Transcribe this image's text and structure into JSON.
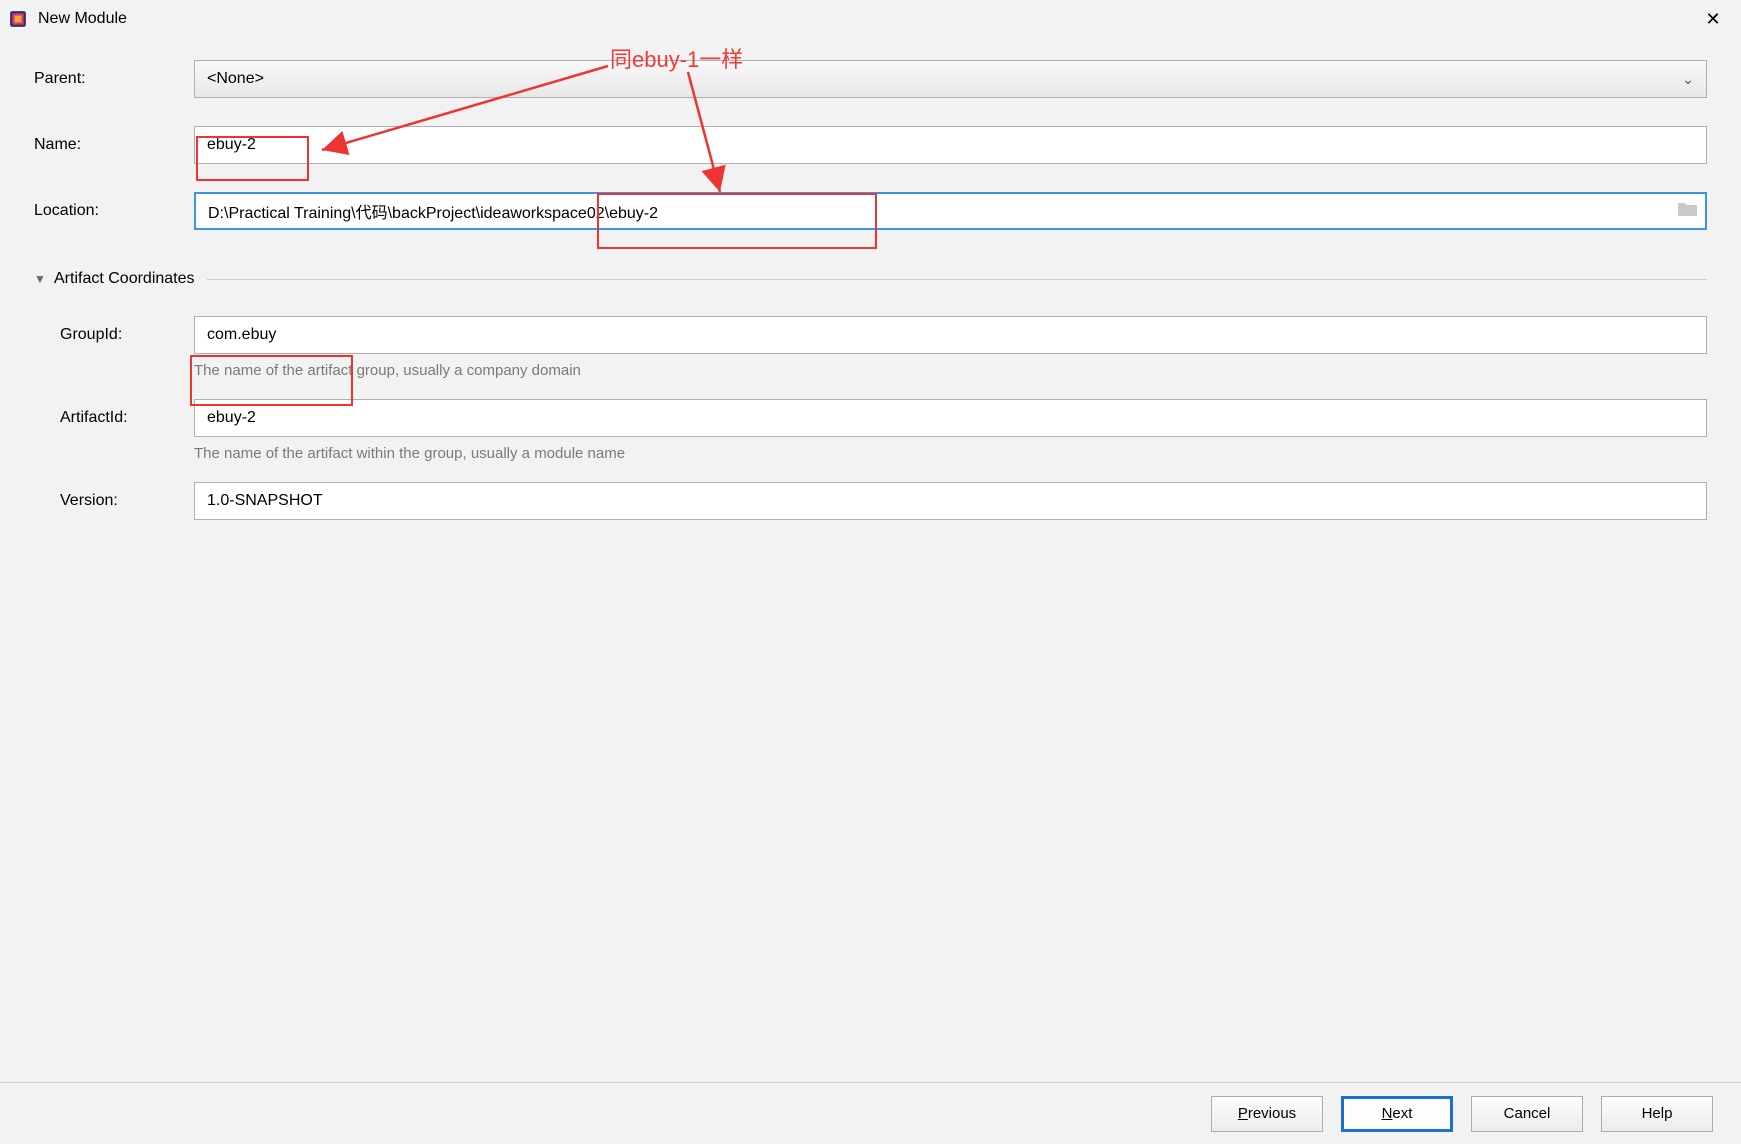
{
  "window": {
    "title": "New Module"
  },
  "annotation": {
    "text": "同ebuy-1一样"
  },
  "form": {
    "parent_label": "Parent:",
    "parent_value": "<None>",
    "name_label": "Name:",
    "name_value": "ebuy-2",
    "location_label": "Location:",
    "location_value": "D:\\Practical Training\\代码\\backProject\\ideaworkspace02\\ebuy-2"
  },
  "artifact": {
    "section_title": "Artifact Coordinates",
    "groupid_label": "GroupId:",
    "groupid_value": "com.ebuy",
    "groupid_hint": "The name of the artifact group, usually a company domain",
    "artifactid_label": "ArtifactId:",
    "artifactid_value": "ebuy-2",
    "artifactid_hint": "The name of the artifact within the group, usually a module name",
    "version_label": "Version:",
    "version_value": "1.0-SNAPSHOT"
  },
  "buttons": {
    "previous": "Previous",
    "next": "Next",
    "cancel": "Cancel",
    "help": "Help"
  }
}
